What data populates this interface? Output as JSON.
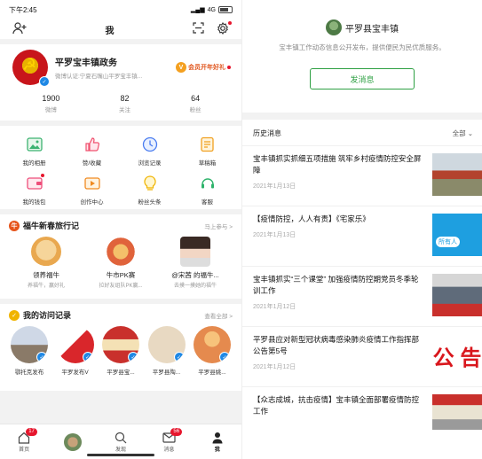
{
  "colors": {
    "accent": "#2ea043",
    "badge": "#e6162d",
    "link": "#1e88e5"
  },
  "status": {
    "time": "下午2:45",
    "network": "4G"
  },
  "nav": {
    "title": "我",
    "left_icon": "add-friend-icon",
    "scan_icon": "scan-icon",
    "settings_icon": "gear-icon"
  },
  "profile": {
    "name": "平罗宝丰镇政务",
    "cert": "微博认证:宁夏石嘴山平罗宝丰镇...",
    "member": "会员开年好礼",
    "stats": [
      {
        "value": "1900",
        "label": "微博"
      },
      {
        "value": "82",
        "label": "关注"
      },
      {
        "value": "64",
        "label": "粉丝"
      }
    ]
  },
  "grid": [
    {
      "label": "我的相册",
      "icon": "album-icon"
    },
    {
      "label": "赞/收藏",
      "icon": "like-icon"
    },
    {
      "label": "浏览记录",
      "icon": "history-icon"
    },
    {
      "label": "草稿箱",
      "icon": "draft-icon"
    },
    {
      "label": "我的钱包",
      "icon": "wallet-icon"
    },
    {
      "label": "创作中心",
      "icon": "creator-icon"
    },
    {
      "label": "粉丝头条",
      "icon": "fans-headline-icon"
    },
    {
      "label": "客服",
      "icon": "service-icon"
    }
  ],
  "travel": {
    "title": "福牛新春旅行记",
    "more": "马上参与 >",
    "items": [
      {
        "name": "领养福牛",
        "desc": "养福牛，赢好礼"
      },
      {
        "name": "牛市PK赛",
        "desc": "拉好友组队PK赢..."
      },
      {
        "name": "@宋茜 的福牛...",
        "desc": "去摸一摸她的福牛"
      }
    ]
  },
  "visits": {
    "title": "我的访问记录",
    "more": "查看全部 >",
    "items": [
      {
        "name": "鄂托克发布"
      },
      {
        "name": "平罗发布V"
      },
      {
        "name": "平罗县宝..."
      },
      {
        "name": "平罗县陶..."
      },
      {
        "name": "平罗县姚..."
      }
    ]
  },
  "tabs": [
    {
      "label": "首页",
      "badge": "17"
    },
    {
      "label": "",
      "badge": ""
    },
    {
      "label": "发现",
      "badge": ""
    },
    {
      "label": "消息",
      "badge": "56"
    },
    {
      "label": "我",
      "badge": ""
    }
  ],
  "account": {
    "name": "平罗县宝丰镇",
    "desc": "宝丰镇工作动态信息公开发布，提供便民为民优质服务。",
    "button": "发消息"
  },
  "history": {
    "title": "历史消息",
    "filter": "全部",
    "items": [
      {
        "title": "宝丰镇抓实抓细五项措施 筑牢乡村疫情防控安全屏障",
        "date": "2021年1月13日"
      },
      {
        "title": "【疫情防控，人人有责】《宅家乐》",
        "date": "2021年1月13日",
        "thumb_text": "所有人"
      },
      {
        "title": "宝丰镇抓实“三个课堂” 加强疫情防控期党员冬季轮训工作",
        "date": "2021年1月12日"
      },
      {
        "title": "平罗县应对新型冠状病毒感染肺炎疫情工作指挥部公告第5号",
        "date": "2021年1月12日",
        "thumb_text": "公 告"
      },
      {
        "title": "【众志成城，抗击疫情】宝丰镇全面部署疫情防控工作",
        "date": ""
      }
    ]
  }
}
